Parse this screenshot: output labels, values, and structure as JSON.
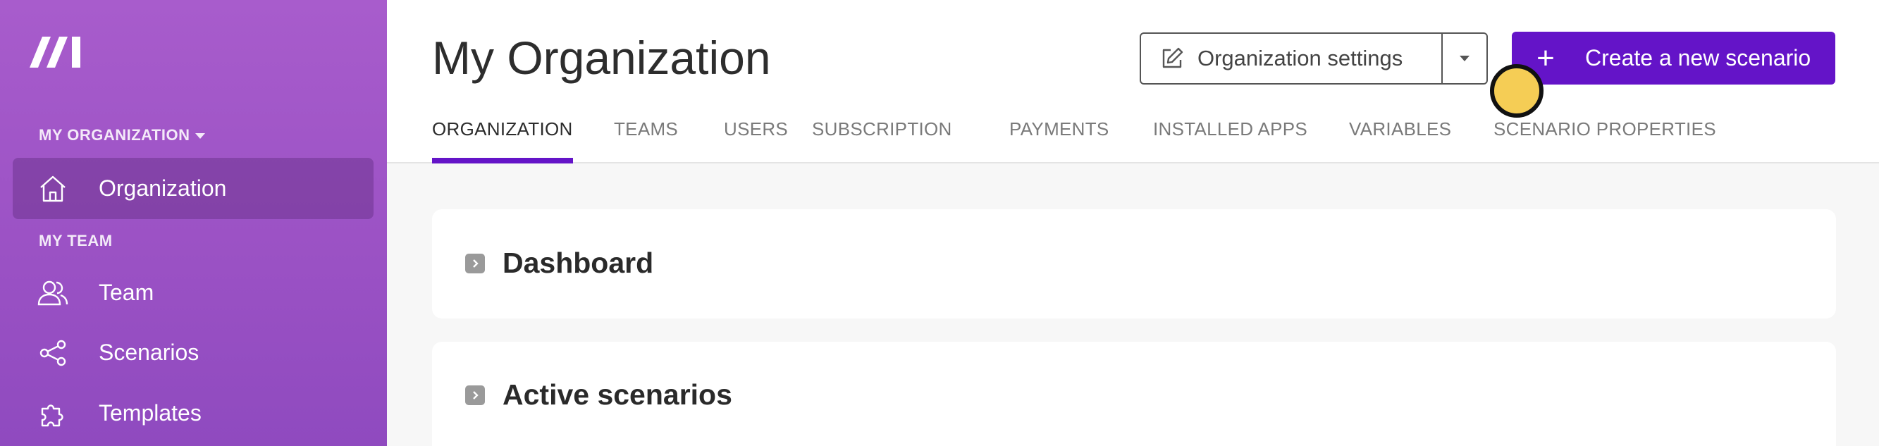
{
  "sidebar": {
    "logo": "make-logo",
    "org_section_label": "MY ORGANIZATION",
    "team_section_label": "MY TEAM",
    "items": [
      {
        "label": "Organization",
        "icon": "home-icon",
        "active": true
      },
      {
        "label": "Team",
        "icon": "users-icon",
        "active": false
      },
      {
        "label": "Scenarios",
        "icon": "share-icon",
        "active": false
      },
      {
        "label": "Templates",
        "icon": "puzzle-icon",
        "active": false
      }
    ]
  },
  "header": {
    "title": "My Organization",
    "settings_button_label": "Organization settings",
    "create_button_label": "Create a new scenario",
    "tabs": [
      {
        "label": "ORGANIZATION",
        "active": true
      },
      {
        "label": "TEAMS",
        "active": false
      },
      {
        "label": "USERS",
        "active": false
      },
      {
        "label": "SUBSCRIPTION",
        "active": false
      },
      {
        "label": "PAYMENTS",
        "active": false
      },
      {
        "label": "INSTALLED APPS",
        "active": false
      },
      {
        "label": "VARIABLES",
        "active": false
      },
      {
        "label": "SCENARIO PROPERTIES",
        "active": false
      }
    ]
  },
  "main": {
    "cards": [
      {
        "title": "Dashboard"
      },
      {
        "title": "Active scenarios"
      }
    ]
  },
  "colors": {
    "brand_purple": "#6414c8",
    "sidebar_purple": "#a85ccc",
    "cursor_marker": "#f5cd55"
  }
}
